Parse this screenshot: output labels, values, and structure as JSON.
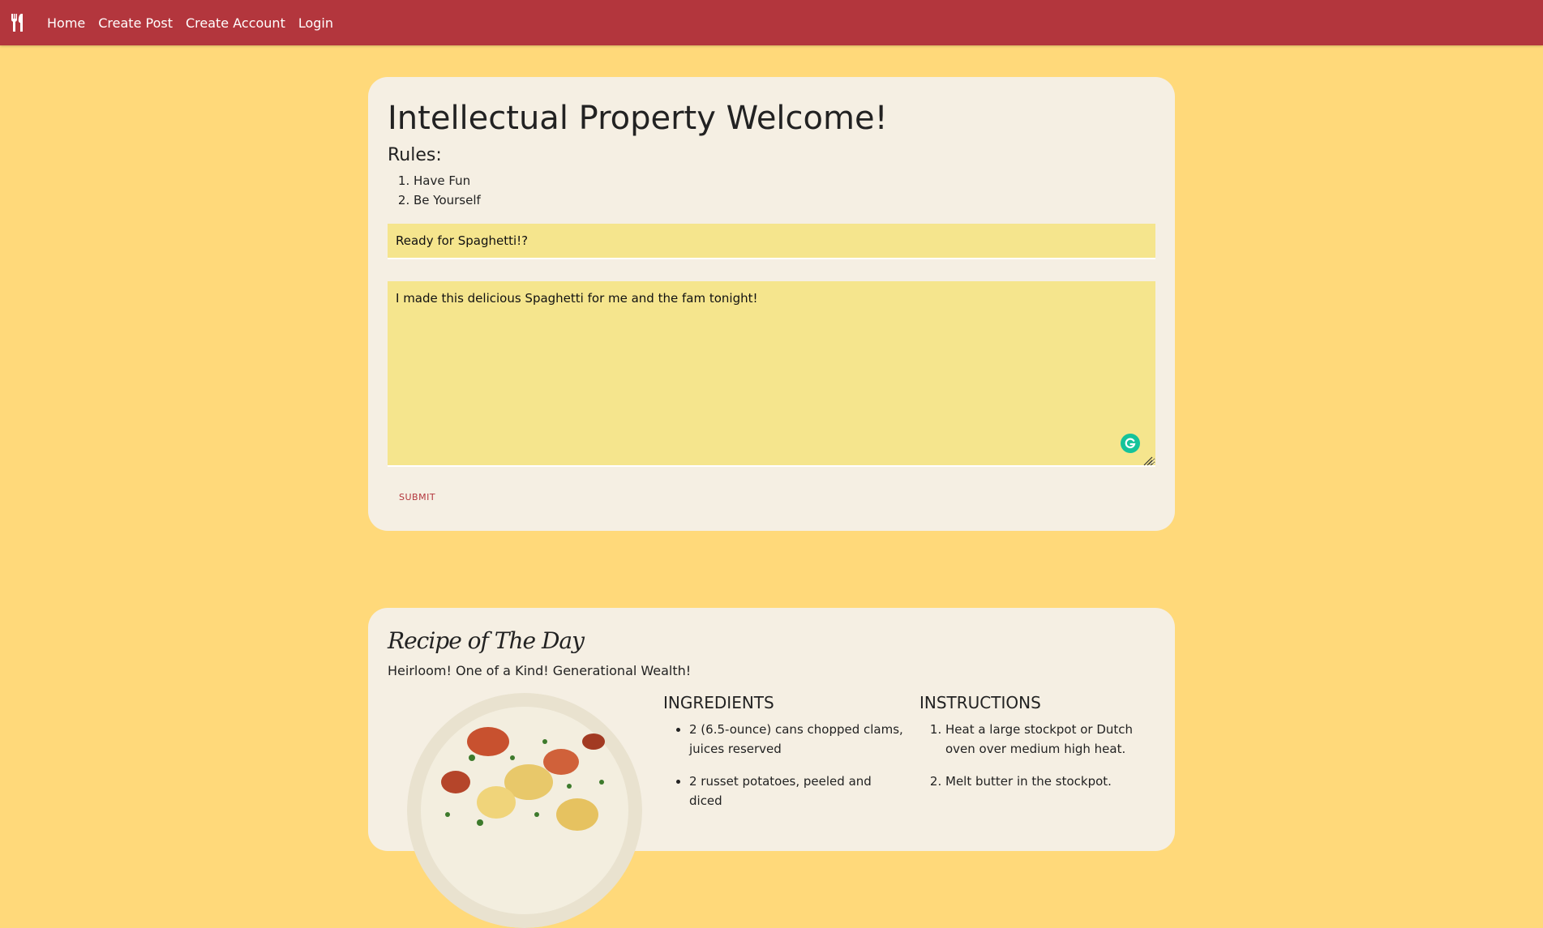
{
  "nav": {
    "brand_icon": "fork-knife-icon",
    "links": [
      "Home",
      "Create Post",
      "Create Account",
      "Login"
    ]
  },
  "post_form": {
    "title": "Intellectual Property Welcome!",
    "rules_heading": "Rules:",
    "rules": [
      "Have Fun",
      "Be Yourself"
    ],
    "title_input_value": "Ready for Spaghetti!?",
    "body_input_value": "I made this delicious Spaghetti for me and the fam tonight!",
    "submit_label": "SUBMIT"
  },
  "recipe": {
    "title": "Recipe of The Day",
    "subtitle": "Heirloom! One of a Kind! Generational Wealth!",
    "ingredients_heading": "INGREDIENTS",
    "ingredients": [
      "2 (6.5-ounce) cans chopped clams, juices reserved",
      "2 russet potatoes, peeled and diced"
    ],
    "instructions_heading": "INSTRUCTIONS",
    "instructions": [
      "Heat a large stockpot or Dutch oven over medium high heat.",
      "Melt butter in the stockpot."
    ]
  },
  "colors": {
    "navbar": "#b3363d",
    "background": "#ffd97a",
    "card": "#f5efe3",
    "input": "#f5e58d",
    "grammarly": "#15c39a"
  }
}
